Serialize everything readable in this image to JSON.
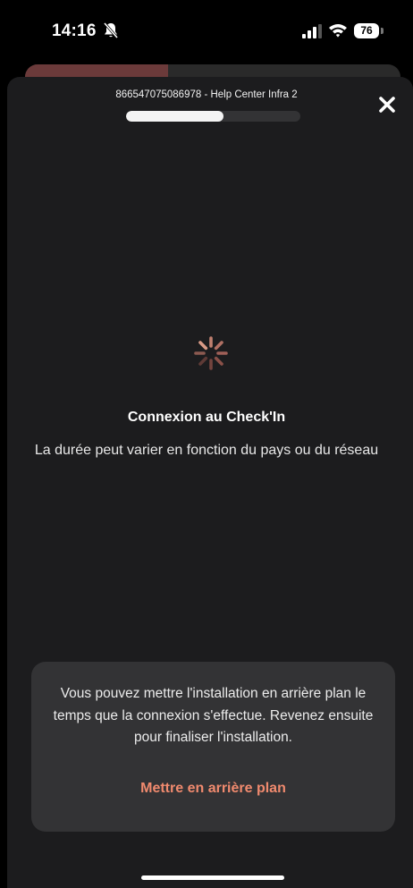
{
  "status_bar": {
    "time": "14:16",
    "battery_level": "76",
    "icons": [
      "bell-muted-icon",
      "cellular-signal-icon",
      "wifi-icon",
      "battery-icon"
    ]
  },
  "header": {
    "title": "866547075086978 - Help Center Infra 2",
    "progress_fraction": 0.56,
    "close_icon": "close-icon"
  },
  "loading": {
    "spinner_icon": "spinner-icon",
    "title": "Connexion au Check'In",
    "description": "La durée peut varier en fonction du pays ou du réseau"
  },
  "background_panel": {
    "message": "Vous pouvez mettre l'installation en arrière plan le temps que la connexion s'effectue. Revenez ensuite pour finaliser l'installation.",
    "button_label": "Mettre en arrière plan"
  },
  "colors": {
    "accent": "#f08a6e",
    "sheet_background": "#1c1c1e",
    "panel_background": "#333335"
  }
}
